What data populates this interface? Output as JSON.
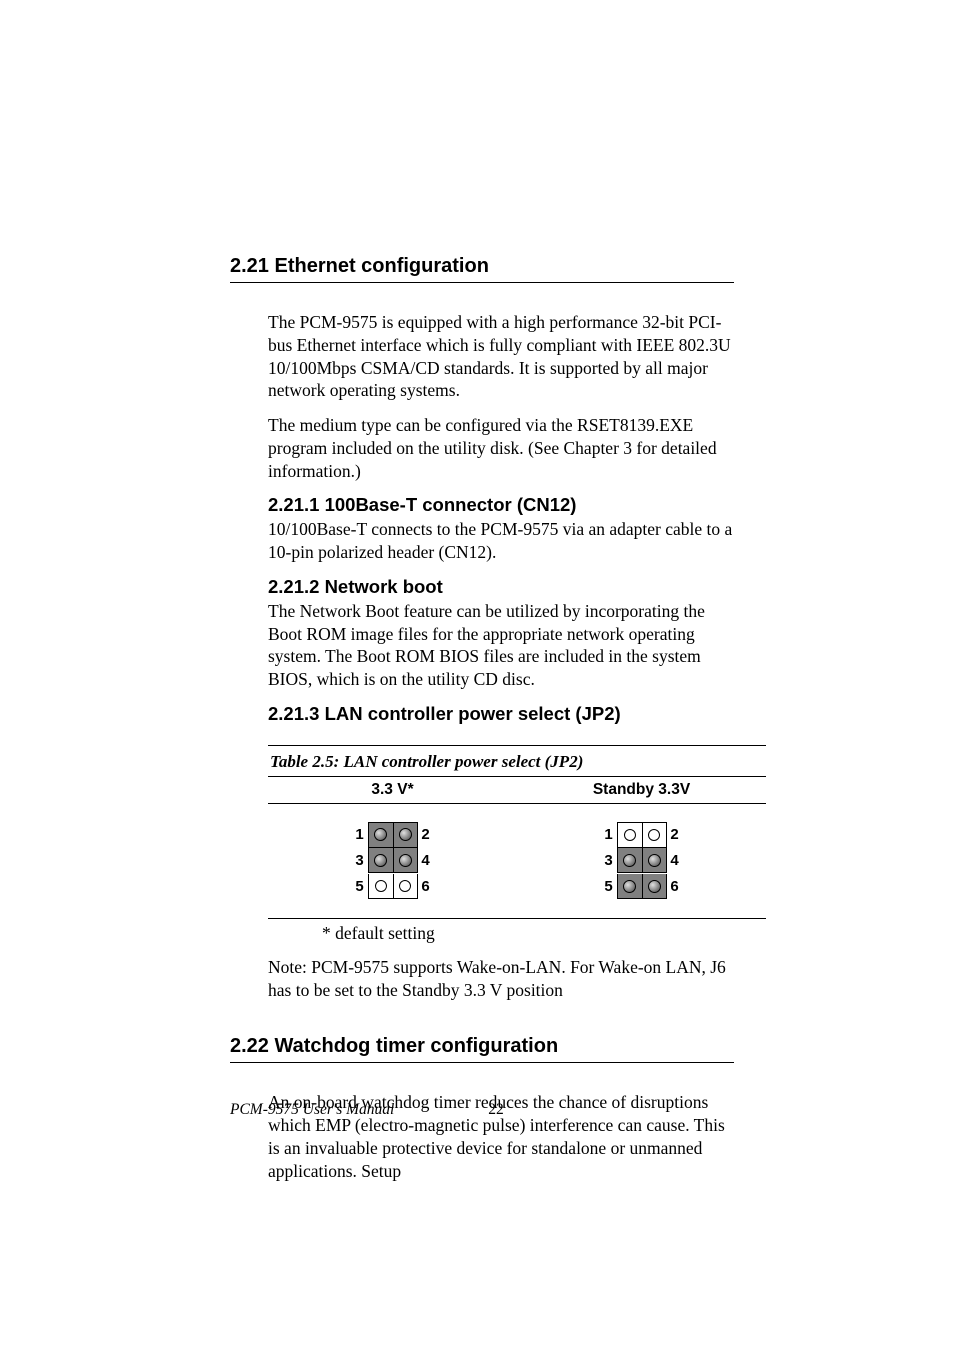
{
  "section21": {
    "heading": "2.21  Ethernet configuration",
    "para1": "The PCM-9575 is equipped with a high performance 32-bit PCI-bus Ethernet interface which is fully compliant with IEEE 802.3U 10/100Mbps CSMA/CD standards. It is supported by all major network operating systems.",
    "para2": "The medium type can be configured via the RSET8139.EXE program included on the utility disk. (See Chapter 3 for detailed information.)",
    "sub1_heading": "2.21.1 100Base-T connector (CN12)",
    "sub1_body": "10/100Base-T connects to the PCM-9575 via an adapter cable to a 10-pin polarized header (CN12).",
    "sub2_heading": "2.21.2 Network boot",
    "sub2_body": "The Network Boot feature can be utilized by incorporating the Boot ROM image files for the appropriate network operating system. The Boot ROM BIOS files are included in the system BIOS, which is on the utility CD disc.",
    "sub3_heading": "2.21.3 LAN controller power select (JP2)",
    "table_title": "Table 2.5: LAN controller power select (JP2)",
    "col1": "3.3 V*",
    "col2": "Standby 3.3V",
    "default_note": "* default setting",
    "wol_note": "Note: PCM-9575 supports Wake-on-LAN. For Wake-on LAN, J6 has to be set to the Standby 3.3 V  position",
    "pins": {
      "p1": "1",
      "p2": "2",
      "p3": "3",
      "p4": "4",
      "p5": "5",
      "p6": "6"
    }
  },
  "section22": {
    "heading": "2.22  Watchdog timer configuration",
    "para1": "An on-board watchdog timer reduces the chance of disruptions which EMP (electro-magnetic pulse) interference can cause. This is an invaluable protective device for standalone or unmanned applications. Setup"
  },
  "footer": {
    "manual": "PCM-9575 User's Manual",
    "page": "22"
  }
}
